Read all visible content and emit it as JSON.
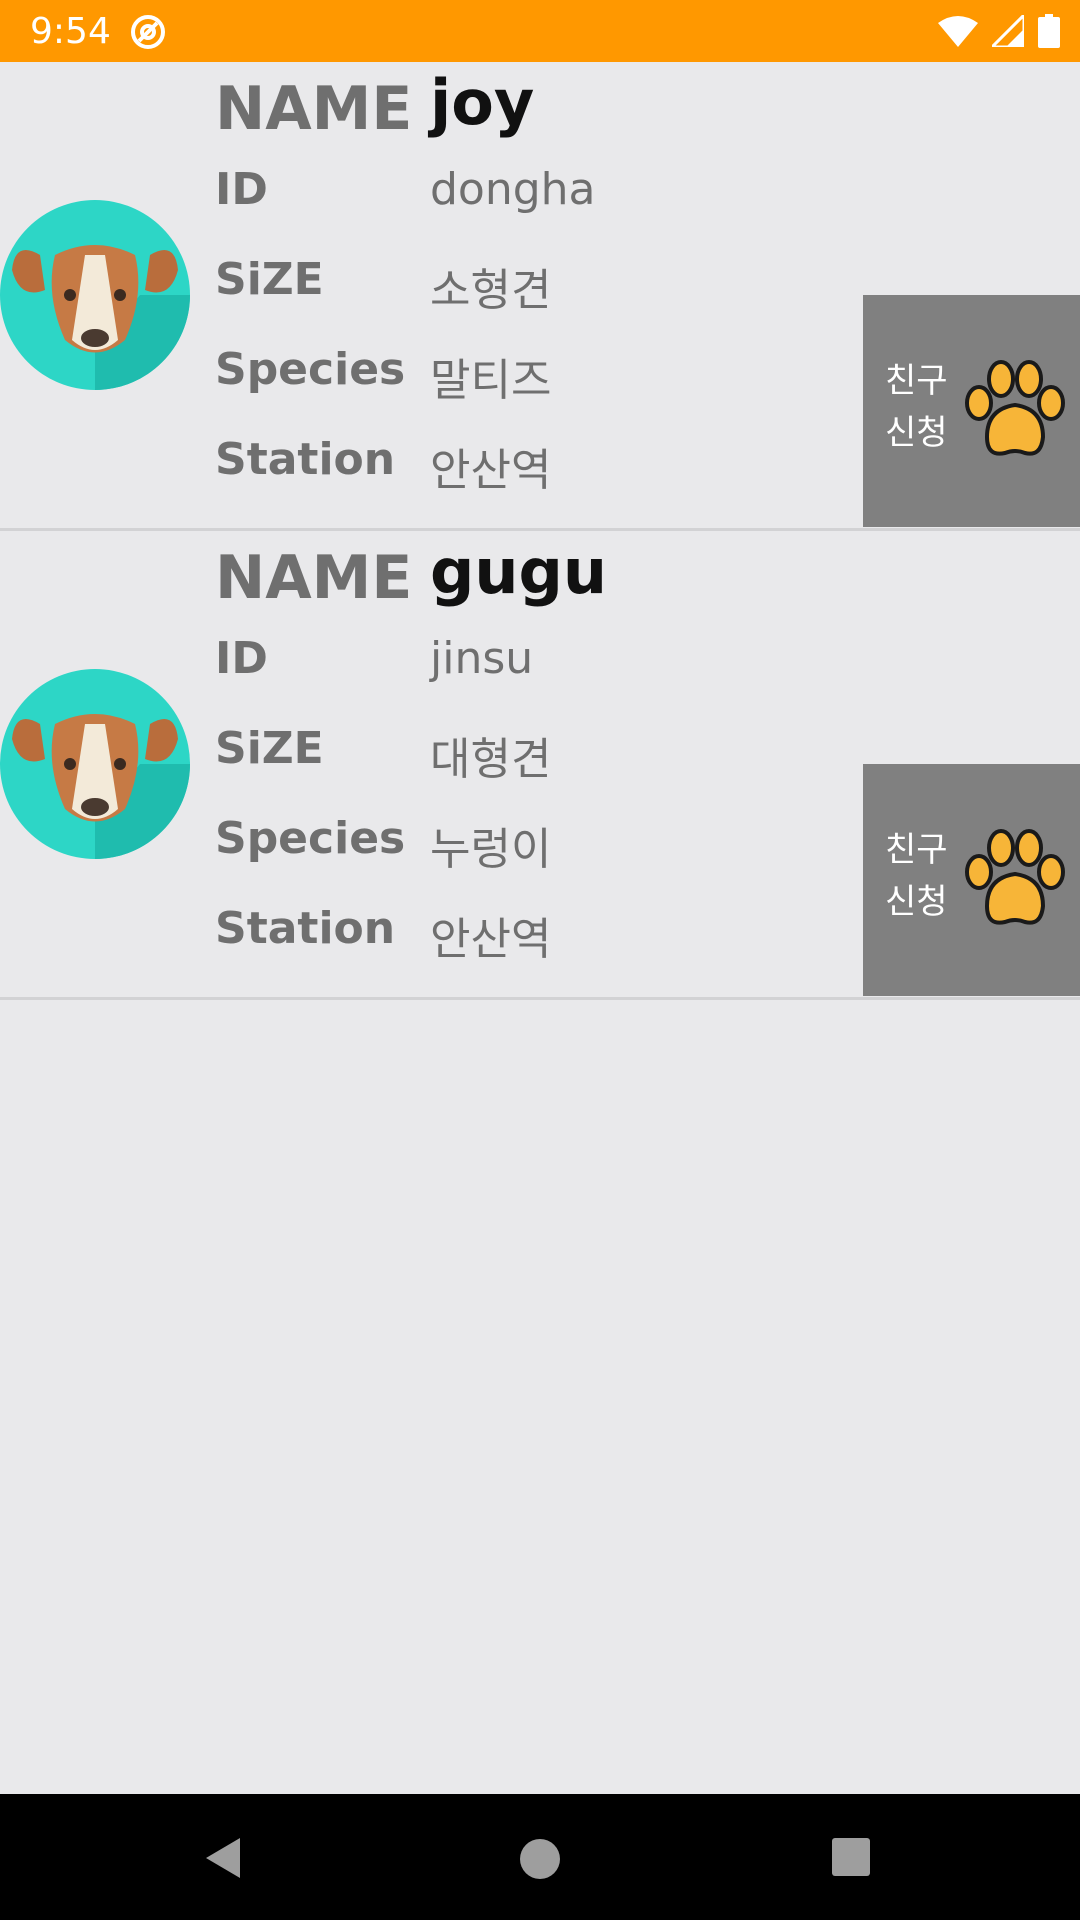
{
  "status_bar": {
    "time": "9:54",
    "icons": [
      "at-icon",
      "wifi-icon",
      "signal-icon",
      "battery-icon"
    ],
    "background_color": "#ff9800"
  },
  "list": {
    "items": [
      {
        "name_label": "NAME",
        "name": "joy",
        "id_label": "ID",
        "id": "dongha",
        "size_label": "SiZE",
        "size": "소형견",
        "species_label": "Species",
        "species": "말티즈",
        "station_label": "Station",
        "station": "안산역",
        "button_label": "친구 신청",
        "avatar_icon": "dog-icon",
        "button_icon": "paw-icon"
      },
      {
        "name_label": "NAME",
        "name": "gugu",
        "id_label": "ID",
        "id": "jinsu",
        "size_label": "SiZE",
        "size": "대형견",
        "species_label": "Species",
        "species": "누렁이",
        "station_label": "Station",
        "station": "안산역",
        "button_label": "친구 신청",
        "avatar_icon": "dog-icon",
        "button_icon": "paw-icon"
      }
    ]
  },
  "nav_bar": {
    "icons": [
      "back-icon",
      "home-icon",
      "recents-icon"
    ]
  },
  "colors": {
    "accent": "#ff9800",
    "background": "#e9e9eb",
    "button_bg": "#808080",
    "paw": "#f7b538"
  }
}
